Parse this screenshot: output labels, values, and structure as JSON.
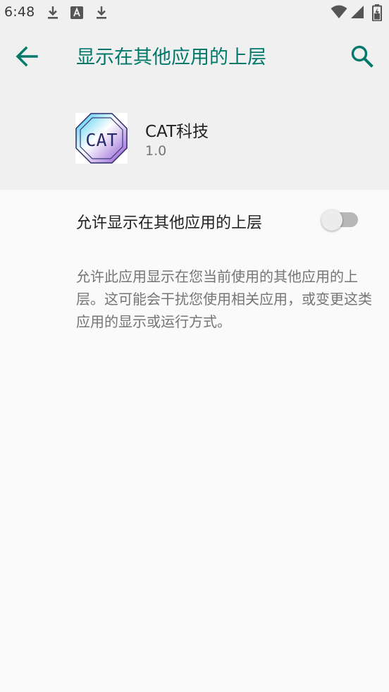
{
  "status_bar": {
    "time": "6:48",
    "icons": [
      "download-icon",
      "text-a-icon",
      "download-icon",
      "wifi-icon",
      "cellular-signal-icon",
      "battery-icon"
    ]
  },
  "app_bar": {
    "title": "显示在其他应用的上层",
    "back_icon": "arrow-back-icon",
    "search_icon": "search-icon",
    "accent_color": "#00796b"
  },
  "app_info": {
    "name": "CAT科技",
    "version": "1.0",
    "logo_text": "CAT"
  },
  "permission": {
    "label": "允许显示在其他应用的上层",
    "enabled": false,
    "description": "允许此应用显示在您当前使用的其他应用的上层。这可能会干扰您使用相关应用，或变更这类应用的显示或运行方式。"
  }
}
